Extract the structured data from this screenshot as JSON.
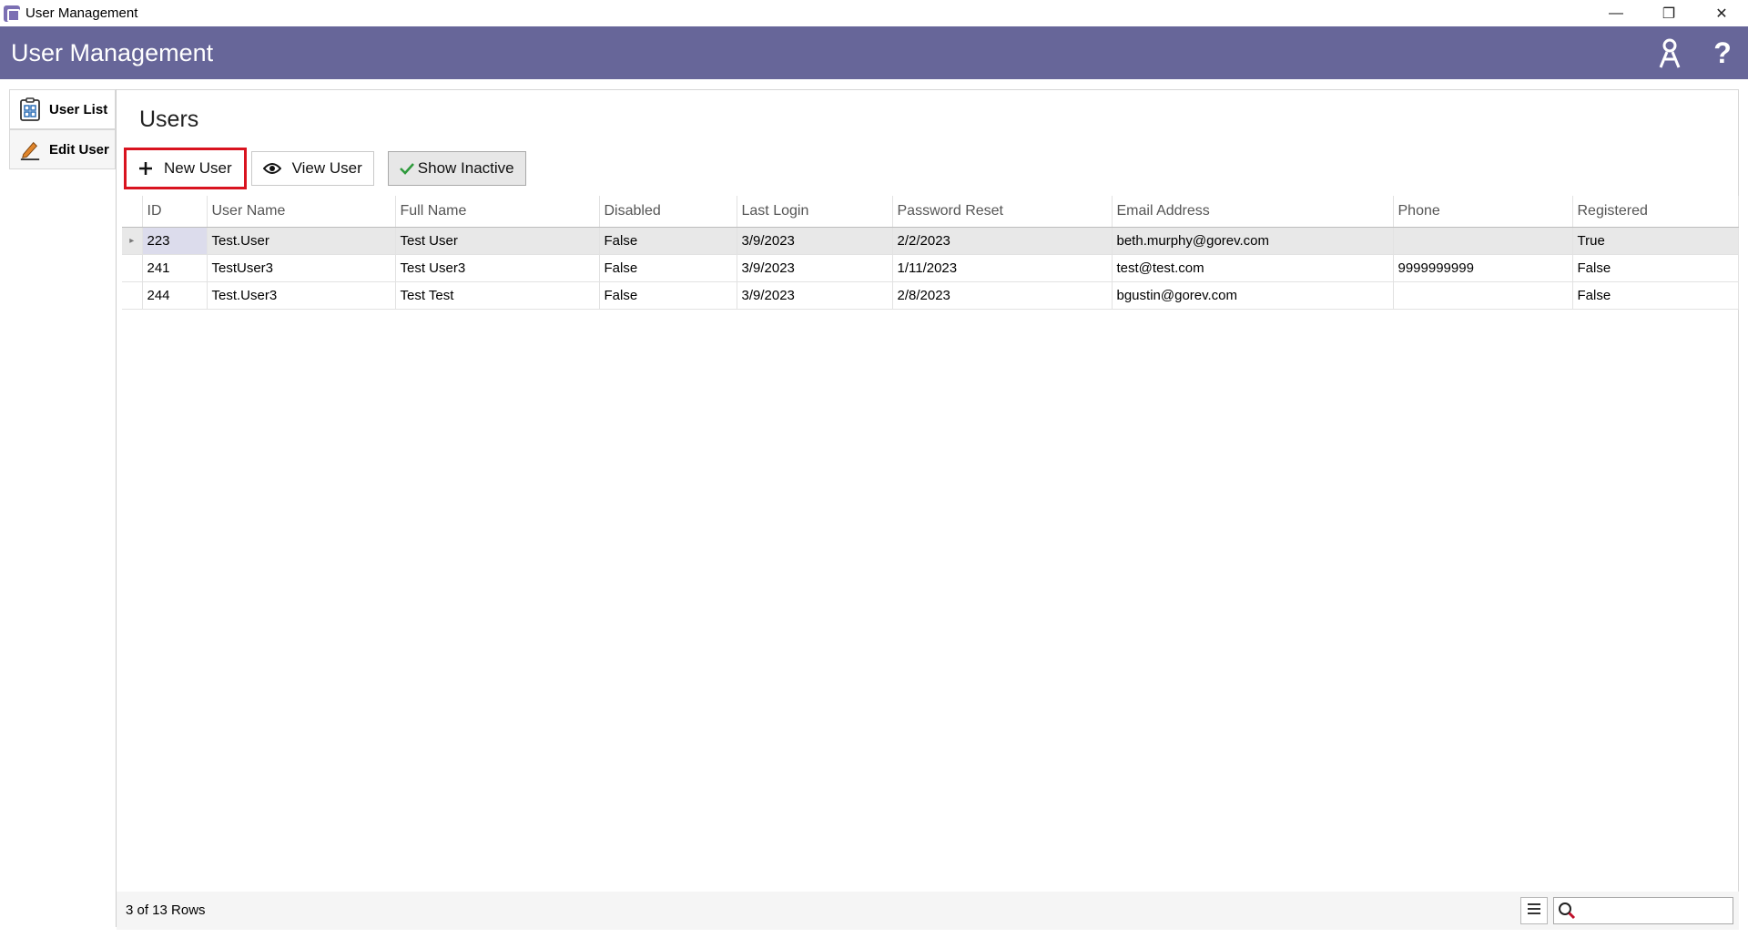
{
  "window": {
    "title": "User Management",
    "minimize": "—",
    "restore": "❐",
    "close": "✕"
  },
  "header": {
    "title": "User Management",
    "help": "?"
  },
  "nav": {
    "items": [
      {
        "label": "User List"
      },
      {
        "label": "Edit User"
      }
    ]
  },
  "main": {
    "title": "Users",
    "toolbar": {
      "new_user": "New User",
      "view_user": "View User",
      "show_inactive": "Show Inactive"
    },
    "columns": [
      "ID",
      "User Name",
      "Full Name",
      "Disabled",
      "Last Login",
      "Password Reset",
      "Email Address",
      "Phone",
      "Registered"
    ],
    "rows": [
      [
        "223",
        "Test.User",
        "Test User",
        "False",
        "3/9/2023",
        "2/2/2023",
        "beth.murphy@gorev.com",
        "",
        "True"
      ],
      [
        "241",
        "TestUser3",
        "Test User3",
        "False",
        "3/9/2023",
        "1/11/2023",
        "test@test.com",
        "9999999999",
        "False"
      ],
      [
        "244",
        "Test.User3",
        "Test Test",
        "False",
        "3/9/2023",
        "2/8/2023",
        "bgustin@gorev.com",
        "",
        "False"
      ]
    ],
    "row_indicator": "▸",
    "footer": {
      "row_count": "3 of 13 Rows",
      "search_placeholder": ""
    }
  },
  "colors": {
    "header_bg": "#676699",
    "highlight_border": "#d9131f",
    "check_green": "#2e9a3c"
  }
}
